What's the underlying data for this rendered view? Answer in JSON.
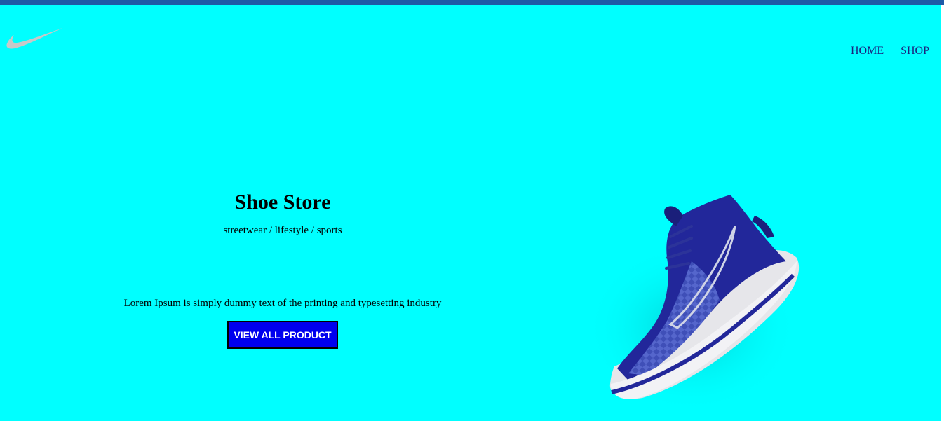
{
  "nav": {
    "items": [
      {
        "label": "HOME"
      },
      {
        "label": "SHOP"
      }
    ]
  },
  "hero": {
    "title": "Shoe Store",
    "subtitle": "streetwear / lifestyle / sports",
    "description": "Lorem Ipsum is simply dummy text of the printing and typesetting industry",
    "cta_label": "VIEW ALL PRODUCT"
  },
  "colors": {
    "background": "#00ffff",
    "topbar": "#1f5aa6",
    "cta_bg": "#0000ee",
    "nav_link": "#1a237e",
    "shoe_primary": "#22279a"
  },
  "icons": {
    "logo": "swoosh-logo-icon",
    "product": "sneaker-image"
  }
}
